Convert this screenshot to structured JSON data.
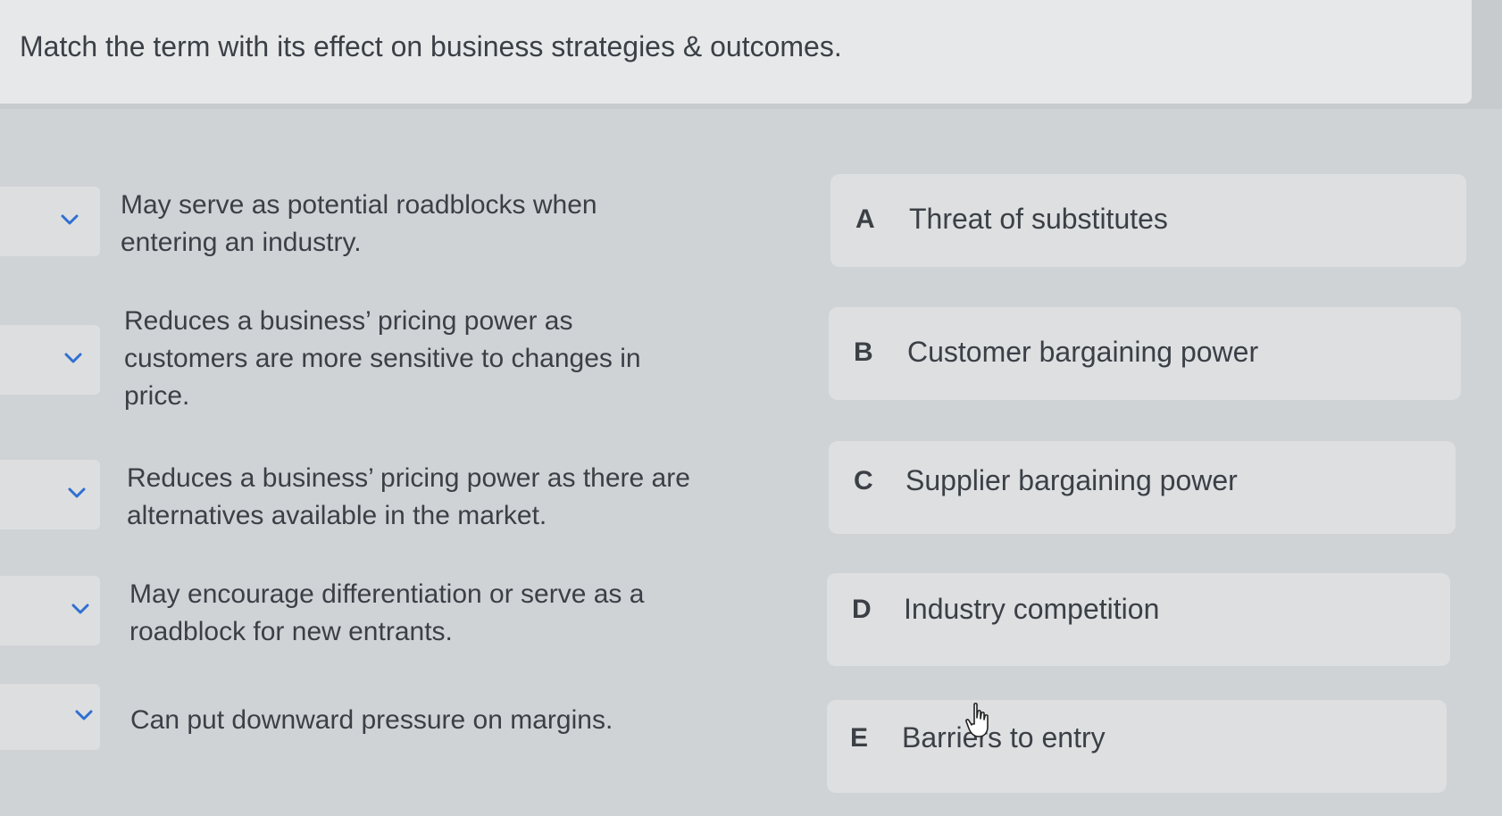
{
  "question": {
    "title": "Match the term with its effect on business strategies & outcomes."
  },
  "prompts": [
    {
      "lines": [
        "May serve as potential roadblocks when",
        "entering an industry."
      ]
    },
    {
      "lines": [
        "Reduces a business’ pricing power as",
        "customers are more sensitive to changes in",
        "price."
      ]
    },
    {
      "lines": [
        "Reduces a business’ pricing power as there are",
        "alternatives available in the market."
      ]
    },
    {
      "lines": [
        "May encourage differentiation or serve as a",
        "roadblock for new entrants."
      ]
    },
    {
      "lines": [
        "Can put downward pressure on margins."
      ]
    }
  ],
  "options": [
    {
      "letter": "A",
      "label": "Threat of substitutes"
    },
    {
      "letter": "B",
      "label": "Customer bargaining power"
    },
    {
      "letter": "C",
      "label": "Supplier bargaining power"
    },
    {
      "letter": "D",
      "label": "Industry competition"
    },
    {
      "letter": "E",
      "label": "Barriers to entry"
    }
  ],
  "icons": {
    "dropdown": "chevron-down-icon",
    "cursor": "hand-pointer-icon"
  },
  "colors": {
    "chevron": "#2f6fd0"
  }
}
